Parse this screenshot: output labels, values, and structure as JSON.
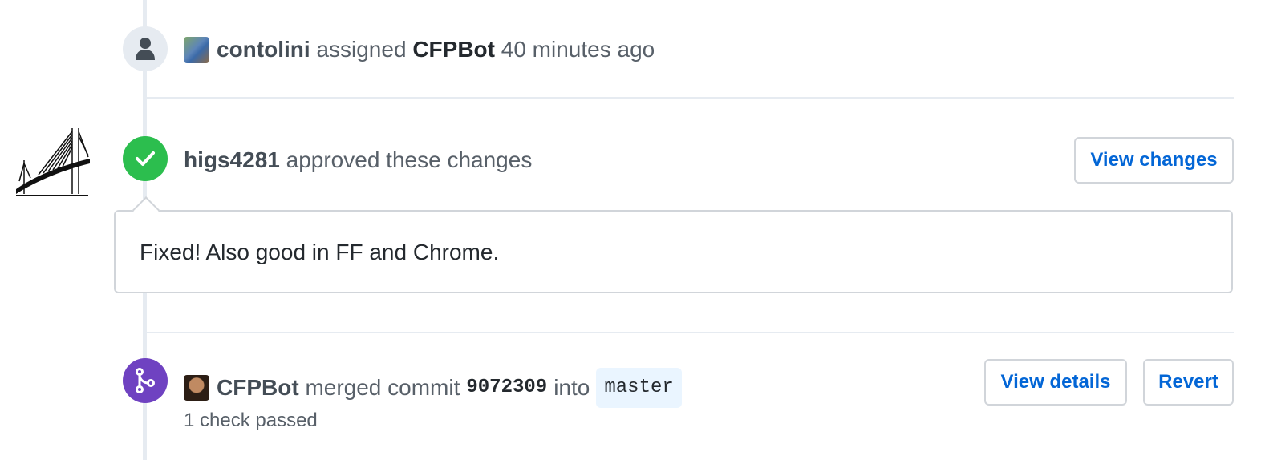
{
  "events": {
    "assigned": {
      "actor": "contolini",
      "action": "assigned",
      "assignee": "CFPBot",
      "time": "40 minutes ago"
    },
    "review": {
      "reviewer": "higs4281",
      "action": "approved these changes",
      "button": "View changes",
      "comment": "Fixed! Also good in FF and Chrome."
    },
    "merge": {
      "actor": "CFPBot",
      "action": "merged commit",
      "commit": "9072309",
      "into": "into",
      "branch": "master",
      "checks": "1 check passed",
      "details_button": "View details",
      "revert_button": "Revert"
    }
  },
  "icons": {
    "assigned_badge": "person-icon",
    "review_badge": "check-icon",
    "merge_badge": "git-merge-icon",
    "reviewer_avatar": "bridge-avatar"
  },
  "colors": {
    "approved": "#2cbe4e",
    "merged": "#6f42c1",
    "link": "#0366d6",
    "timeline": "#e6ebf1"
  }
}
